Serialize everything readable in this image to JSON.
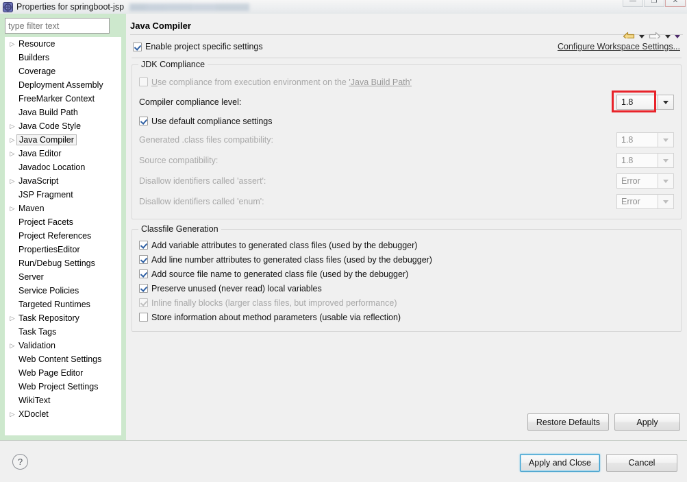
{
  "window": {
    "title": "Properties for springboot-jsp",
    "icon": "eclipse-properties-icon",
    "minimize_label": "—",
    "maximize_label": "❐",
    "close_label": "✕"
  },
  "sidebar": {
    "filter_placeholder": "type filter text",
    "filter_value": "",
    "items": [
      {
        "label": "Resource",
        "expandable": true,
        "selected": false
      },
      {
        "label": "Builders",
        "expandable": false,
        "selected": false
      },
      {
        "label": "Coverage",
        "expandable": false,
        "selected": false
      },
      {
        "label": "Deployment Assembly",
        "expandable": false,
        "selected": false
      },
      {
        "label": "FreeMarker Context",
        "expandable": false,
        "selected": false
      },
      {
        "label": "Java Build Path",
        "expandable": false,
        "selected": false
      },
      {
        "label": "Java Code Style",
        "expandable": true,
        "selected": false
      },
      {
        "label": "Java Compiler",
        "expandable": true,
        "selected": true
      },
      {
        "label": "Java Editor",
        "expandable": true,
        "selected": false
      },
      {
        "label": "Javadoc Location",
        "expandable": false,
        "selected": false
      },
      {
        "label": "JavaScript",
        "expandable": true,
        "selected": false
      },
      {
        "label": "JSP Fragment",
        "expandable": false,
        "selected": false
      },
      {
        "label": "Maven",
        "expandable": true,
        "selected": false
      },
      {
        "label": "Project Facets",
        "expandable": false,
        "selected": false
      },
      {
        "label": "Project References",
        "expandable": false,
        "selected": false
      },
      {
        "label": "PropertiesEditor",
        "expandable": false,
        "selected": false
      },
      {
        "label": "Run/Debug Settings",
        "expandable": false,
        "selected": false
      },
      {
        "label": "Server",
        "expandable": false,
        "selected": false
      },
      {
        "label": "Service Policies",
        "expandable": false,
        "selected": false
      },
      {
        "label": "Targeted Runtimes",
        "expandable": false,
        "selected": false
      },
      {
        "label": "Task Repository",
        "expandable": true,
        "selected": false
      },
      {
        "label": "Task Tags",
        "expandable": false,
        "selected": false
      },
      {
        "label": "Validation",
        "expandable": true,
        "selected": false
      },
      {
        "label": "Web Content Settings",
        "expandable": false,
        "selected": false
      },
      {
        "label": "Web Page Editor",
        "expandable": false,
        "selected": false
      },
      {
        "label": "Web Project Settings",
        "expandable": false,
        "selected": false
      },
      {
        "label": "WikiText",
        "expandable": false,
        "selected": false
      },
      {
        "label": "XDoclet",
        "expandable": true,
        "selected": false
      }
    ]
  },
  "page": {
    "title": "Java Compiler",
    "enable_project_specific": {
      "label": "Enable project specific settings",
      "checked": true
    },
    "configure_workspace_link": "Configure Workspace Settings...",
    "jdk_compliance": {
      "group_title": "JDK Compliance",
      "use_execution_env": {
        "label_before": "se compliance from execution environment on the ",
        "mnemonic": "U",
        "link_text": "'Java Build Path'",
        "checked": false,
        "enabled": false
      },
      "compiler_compliance_level": {
        "label": "Compiler compliance level:",
        "value": "1.8",
        "highlighted": true,
        "enabled": true
      },
      "use_default_compliance": {
        "label": "Use default compliance settings",
        "checked": true,
        "enabled": true
      },
      "fields": [
        {
          "label": "Generated .class files compatibility:",
          "value": "1.8",
          "enabled": false
        },
        {
          "label": "Source compatibility:",
          "value": "1.8",
          "enabled": false
        },
        {
          "label": "Disallow identifiers called 'assert':",
          "value": "Error",
          "enabled": false
        },
        {
          "label": "Disallow identifiers called 'enum':",
          "value": "Error",
          "enabled": false
        }
      ]
    },
    "classfile_generation": {
      "group_title": "Classfile Generation",
      "options": [
        {
          "label": "Add variable attributes to generated class files (used by the debugger)",
          "checked": true,
          "enabled": true
        },
        {
          "label": "Add line number attributes to generated class files (used by the debugger)",
          "checked": true,
          "enabled": true
        },
        {
          "label": "Add source file name to generated class file (used by the debugger)",
          "checked": true,
          "enabled": true
        },
        {
          "label": "Preserve unused (never read) local variables",
          "checked": true,
          "enabled": true
        },
        {
          "label": "Inline finally blocks (larger class files, but improved performance)",
          "checked": true,
          "enabled": false
        },
        {
          "label": "Store information about method parameters (usable via reflection)",
          "checked": false,
          "enabled": true
        }
      ]
    },
    "restore_defaults_label": "Restore Defaults",
    "apply_label": "Apply"
  },
  "footer": {
    "help_label": "?",
    "apply_and_close_label": "Apply and Close",
    "cancel_label": "Cancel"
  },
  "colors": {
    "accent_highlight": "#e8232a",
    "sidebar_background": "#cde8cd",
    "default_button_focus": "#3a9ccb",
    "checkbox_check": "#2e5fa3"
  }
}
